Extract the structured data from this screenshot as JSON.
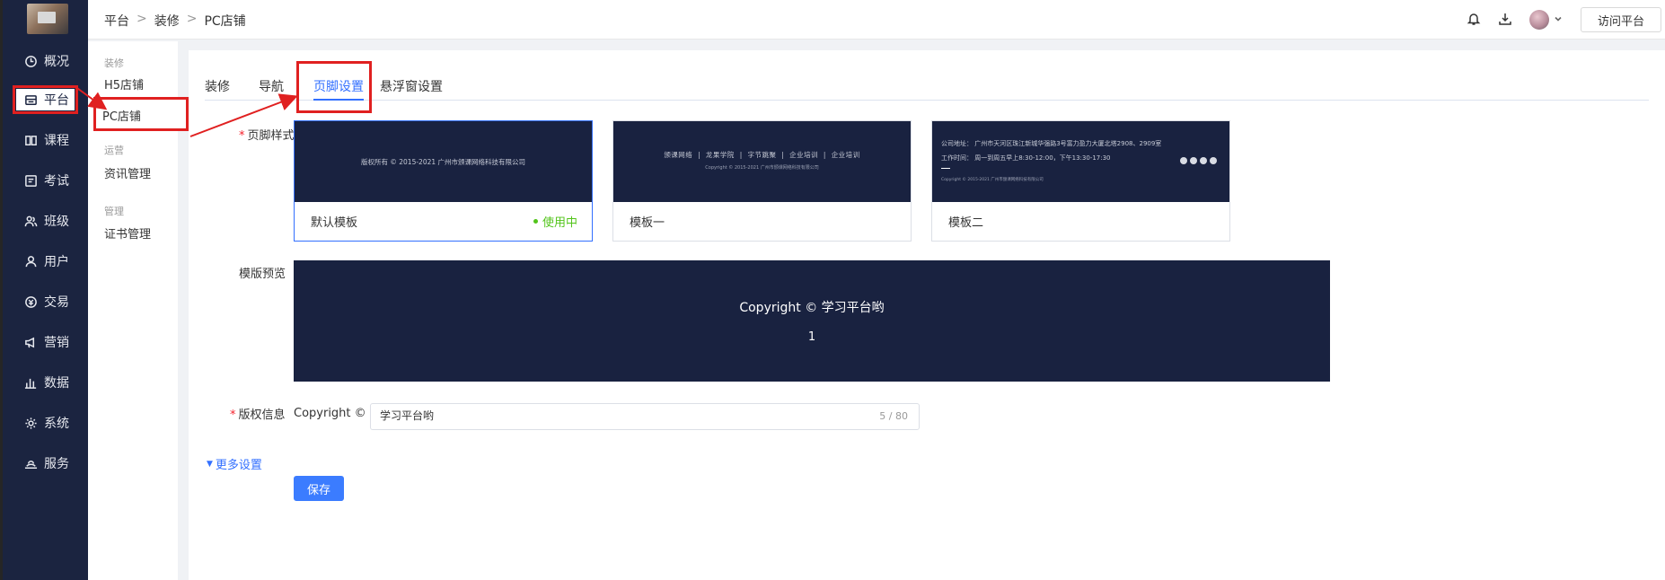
{
  "sidebar": {
    "items": [
      {
        "label": "概况",
        "icon": "clock-icon"
      },
      {
        "label": "平台",
        "icon": "store-icon"
      },
      {
        "label": "课程",
        "icon": "book-icon"
      },
      {
        "label": "考试",
        "icon": "exam-icon"
      },
      {
        "label": "班级",
        "icon": "group-icon"
      },
      {
        "label": "用户",
        "icon": "user-icon"
      },
      {
        "label": "交易",
        "icon": "transaction-icon"
      },
      {
        "label": "营销",
        "icon": "megaphone-icon"
      },
      {
        "label": "数据",
        "icon": "bar-chart-icon"
      },
      {
        "label": "系统",
        "icon": "gear-icon"
      },
      {
        "label": "服务",
        "icon": "service-icon"
      }
    ],
    "active": "平台"
  },
  "submenu": {
    "groups": [
      {
        "title": "装修",
        "items": [
          "H5店铺",
          "PC店铺"
        ]
      },
      {
        "title": "运营",
        "items": [
          "资讯管理"
        ]
      },
      {
        "title": "管理",
        "items": [
          "证书管理"
        ]
      }
    ],
    "active": "PC店铺"
  },
  "header": {
    "breadcrumb": [
      "平台",
      "装修",
      "PC店铺"
    ],
    "separator": ">",
    "visit_button": "访问平台"
  },
  "tabs": [
    "装修",
    "导航",
    "页脚设置",
    "悬浮窗设置"
  ],
  "active_tab": "页脚设置",
  "form": {
    "footer_style_label": "页脚样式",
    "templates": [
      {
        "name": "默认模板",
        "status": "使用中",
        "thumb": {
          "text": "版权所有 © 2015-2021 广州市颁课网络科技有限公司"
        }
      },
      {
        "name": "模板一",
        "thumb": {
          "links": [
            "颁课网络",
            "|",
            "龙果学院",
            "|",
            "字节跳聚",
            "|",
            "企业培训",
            "|",
            "企业培训"
          ],
          "copyright": "Copyright © 2015-2021 广州市颁课网络科技有限公司"
        }
      },
      {
        "name": "模板二",
        "thumb": {
          "address": "公司地址：  广州市天河区珠江新城华强路3号富力盈力大厦北塔2908、2909室",
          "hours": "工作时间：  周一到周五早上8:30-12:00，下午13:30-17:30",
          "copyright": "Copyright © 2015-2021 广州市颁课网络科技有限公司"
        }
      }
    ],
    "preview_label": "模版预览",
    "preview_line1": "Copyright ©  学习平台哟",
    "preview_line2": "1",
    "copyright_label": "版权信息",
    "copyright_prefix": "Copyright ©",
    "copyright_value": "学习平台哟",
    "copyright_count": "5 / 80",
    "more_settings": "更多设置",
    "save_button": "保存"
  },
  "colors": {
    "sidebar_bg": "#1b2440",
    "accent": "#3370ff",
    "success": "#52c41a",
    "annotation": "#e02020",
    "footer_bg": "#192240"
  }
}
